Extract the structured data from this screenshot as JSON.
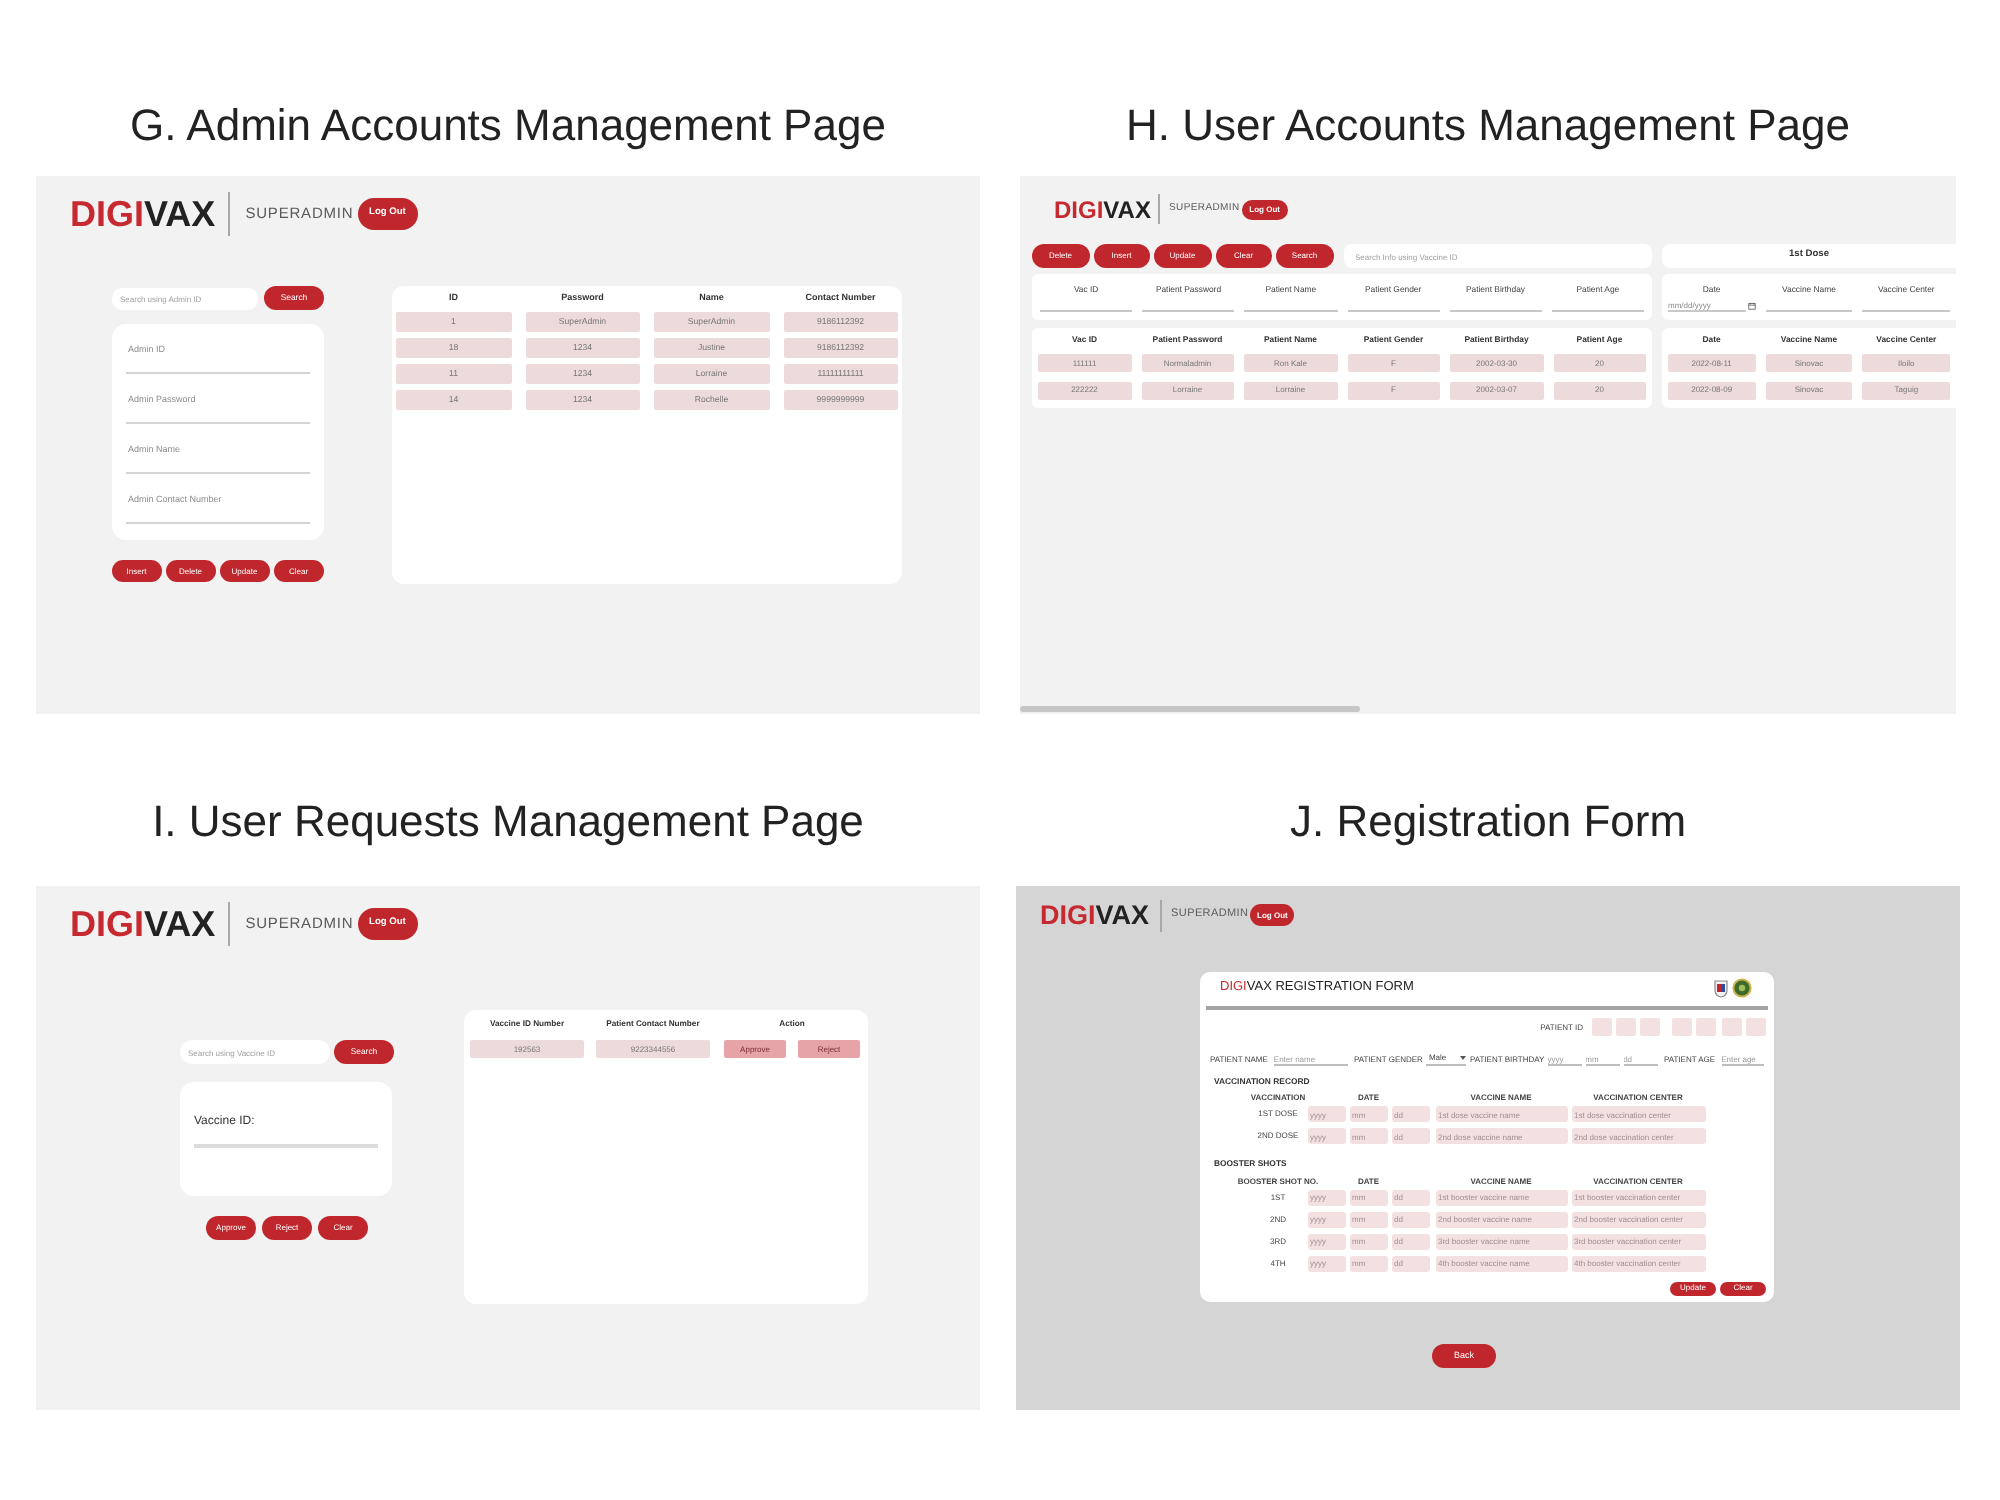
{
  "admin_accounts_page": {
    "caption": "G. Admin Accounts Management Page",
    "header": {
      "logo": {
        "accent": "DIGI",
        "text": "VAX"
      },
      "role": "SUPERADMIN",
      "logout": "Log Out"
    },
    "search": {
      "placeholder": "Search using Admin ID",
      "button": "Search"
    },
    "form_fields": [
      {
        "placeholder": "Admin ID"
      },
      {
        "placeholder": "Admin Password"
      },
      {
        "placeholder": "Admin Name"
      },
      {
        "placeholder": "Admin Contact Number"
      }
    ],
    "buttons": [
      "Insert",
      "Delete",
      "Update",
      "Clear"
    ],
    "table": {
      "columns": [
        "ID",
        "Password",
        "Name",
        "Contact Number"
      ],
      "rows": [
        [
          "1",
          "SuperAdmin",
          "SuperAdmin",
          "9186112392"
        ],
        [
          "18",
          "1234",
          "Justine",
          "9186112392"
        ],
        [
          "11",
          "1234",
          "Lorraine",
          "11111111111"
        ],
        [
          "14",
          "1234",
          "Rochelle",
          "9999999999"
        ]
      ]
    }
  },
  "user_accounts_page": {
    "caption": "H. User Accounts Management Page",
    "header": {
      "logo": {
        "accent": "DIGI",
        "text": "VAX"
      },
      "role": "SUPERADMIN",
      "logout": "Log Out"
    },
    "toolbar_buttons": [
      "Delete",
      "Insert",
      "Update",
      "Clear",
      "Search"
    ],
    "search": {
      "placeholder": "Search Info using Vaccine ID"
    },
    "dose_panel": {
      "title": "1st Dose",
      "fields": [
        {
          "kind": "date",
          "label": "Date",
          "placeholder": "mm/dd/yyyy"
        },
        {
          "kind": "text",
          "label": "Vaccine Name"
        },
        {
          "kind": "text",
          "label": "Vaccine Center"
        }
      ]
    },
    "patient_form": {
      "fields": [
        {
          "label": "Vac ID"
        },
        {
          "label": "Patient Password"
        },
        {
          "label": "Patient Name"
        },
        {
          "label": "Patient Gender"
        },
        {
          "label": "Patient Birthday"
        },
        {
          "label": "Patient Age"
        }
      ]
    },
    "patient_table": {
      "columns": [
        "Vac ID",
        "Patient Password",
        "Patient Name",
        "Patient Gender",
        "Patient Birthday",
        "Patient Age"
      ],
      "rows": [
        [
          "111111",
          "Normaladmin",
          "Ron Kale",
          "F",
          "2002-03-30",
          "20"
        ],
        [
          "222222",
          "Lorraine",
          "Lorraine",
          "F",
          "2002-03-07",
          "20"
        ]
      ]
    },
    "dose_table": {
      "columns": [
        "Date",
        "Vaccine Name",
        "Vaccine Center"
      ],
      "rows": [
        [
          "2022-08-11",
          "Sinovac",
          "Iloilo"
        ],
        [
          "2022-08-09",
          "Sinovac",
          "Taguig"
        ]
      ]
    }
  },
  "user_requests_page": {
    "caption": "I. User Requests Management Page",
    "header": {
      "logo": {
        "accent": "DIGI",
        "text": "VAX"
      },
      "role": "SUPERADMIN",
      "logout": "Log Out"
    },
    "search": {
      "placeholder": "Search using Vaccine ID",
      "button": "Search"
    },
    "form_field": {
      "label": "Vaccine ID:"
    },
    "buttons": [
      "Approve",
      "Reject",
      "Clear"
    ],
    "table": {
      "columns": [
        "Vaccine ID Number",
        "Patient Contact Number",
        "Action"
      ],
      "rows": [
        {
          "cells": [
            "192563",
            "9223344556"
          ],
          "actions": [
            "Approve",
            "Reject"
          ]
        }
      ]
    }
  },
  "registration_form_page": {
    "caption": "J. Registration Form",
    "header": {
      "logo": {
        "accent": "DIGI",
        "text": "VAX"
      },
      "role": "SUPERADMIN",
      "logout": "Log Out"
    },
    "form": {
      "title": {
        "accent": "DIGI",
        "text": "VAX REGISTRATION FORM"
      },
      "patient_id_label": "PATIENT ID",
      "patient_fields": [
        {
          "kind": "text",
          "label": "PATIENT NAME",
          "placeholder": "Enter name"
        },
        {
          "kind": "select",
          "label": "PATIENT GENDER",
          "value": "Male"
        },
        {
          "kind": "date",
          "label": "PATIENT BIRTHDAY",
          "fields": [
            {
              "placeholder": "yyyy"
            },
            {
              "placeholder": "mm"
            },
            {
              "placeholder": "dd"
            }
          ]
        },
        {
          "kind": "text",
          "label": "PATIENT AGE",
          "placeholder": "Enter age"
        }
      ],
      "vaccination_record": {
        "title": "VACCINATION RECORD",
        "columns": [
          "VACCINATION",
          "DATE",
          "VACCINE NAME",
          "VACCINATION CENTER"
        ],
        "rows": [
          {
            "label": "1ST DOSE",
            "date": [
              {
                "placeholder": "yyyy"
              },
              {
                "placeholder": "mm"
              },
              {
                "placeholder": "dd"
              }
            ],
            "vaccine_name": {
              "placeholder": "1st dose vaccine name"
            },
            "vaccination_center": {
              "placeholder": "1st dose vaccination center"
            }
          },
          {
            "label": "2ND DOSE",
            "date": [
              {
                "placeholder": "yyyy"
              },
              {
                "placeholder": "mm"
              },
              {
                "placeholder": "dd"
              }
            ],
            "vaccine_name": {
              "placeholder": "2nd dose vaccine name"
            },
            "vaccination_center": {
              "placeholder": "2nd dose vaccination center"
            }
          }
        ]
      },
      "booster_shots": {
        "title": "BOOSTER SHOTS",
        "columns": [
          "BOOSTER SHOT NO.",
          "DATE",
          "VACCINE NAME",
          "VACCINATION CENTER"
        ],
        "rows": [
          {
            "label": "1ST",
            "date": [
              {
                "placeholder": "yyyy"
              },
              {
                "placeholder": "mm"
              },
              {
                "placeholder": "dd"
              }
            ],
            "vaccine_name": {
              "placeholder": "1st booster vaccine name"
            },
            "vaccination_center": {
              "placeholder": "1st booster vaccination center"
            }
          },
          {
            "label": "2ND",
            "date": [
              {
                "placeholder": "yyyy"
              },
              {
                "placeholder": "mm"
              },
              {
                "placeholder": "dd"
              }
            ],
            "vaccine_name": {
              "placeholder": "2nd booster vaccine name"
            },
            "vaccination_center": {
              "placeholder": "2nd booster vaccination center"
            }
          },
          {
            "label": "3RD",
            "date": [
              {
                "placeholder": "yyyy"
              },
              {
                "placeholder": "mm"
              },
              {
                "placeholder": "dd"
              }
            ],
            "vaccine_name": {
              "placeholder": "3rd booster vaccine name"
            },
            "vaccination_center": {
              "placeholder": "3rd booster vaccination center"
            }
          },
          {
            "label": "4TH",
            "date": [
              {
                "placeholder": "yyyy"
              },
              {
                "placeholder": "mm"
              },
              {
                "placeholder": "dd"
              }
            ],
            "vaccine_name": {
              "placeholder": "4th booster vaccine name"
            },
            "vaccination_center": {
              "placeholder": "4th booster vaccination center"
            }
          }
        ]
      },
      "buttons": [
        "Update",
        "Clear"
      ]
    },
    "back_button": "Back"
  }
}
